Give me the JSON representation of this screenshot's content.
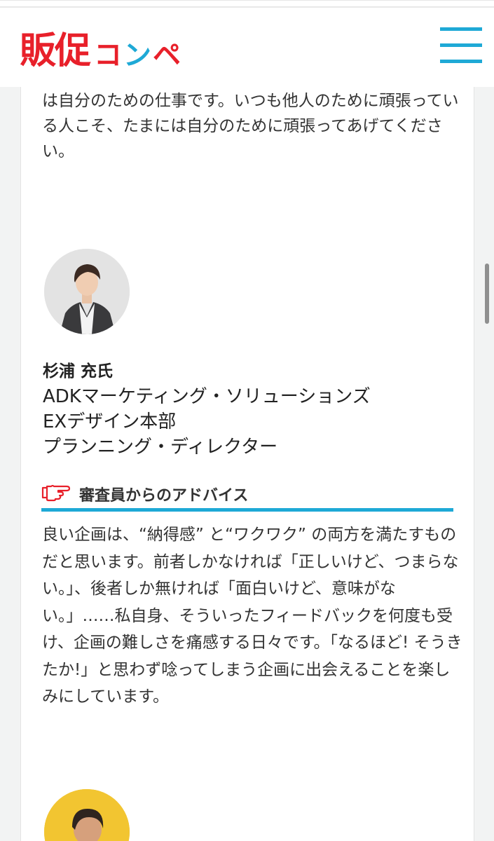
{
  "header": {
    "logo_text": "販促コンペ",
    "logo_chars": [
      "販",
      "促",
      "コ",
      "ン",
      "ペ"
    ],
    "brand_red": "#e8202a",
    "brand_blue": "#1ea9d6",
    "menu_icon": "hamburger-menu-icon"
  },
  "intro": {
    "text": "は自分のための仕事です。いつも他人のために頑張っている人こそ、たまには自分のために頑張ってあげてください。"
  },
  "judge": {
    "name": "杉浦 充氏",
    "affiliation_lines": [
      "ADKマーケティング・ソリューションズ",
      "EXデザイン本部",
      "プランニング・ディレクター"
    ],
    "avatar_icon": "judge-portrait-icon"
  },
  "advice": {
    "heading": "審査員からのアドバイス",
    "heading_icon": "pointing-hand-icon",
    "text": "良い企画は、“納得感” と“ワクワク” の両方を満たすものだと思います。前者しかなければ「正しいけど、つまらない。」、後者しか無ければ「面白いけど、意味がない。」……私自身、そういったフィードバックを何度も受け、企画の難しさを痛感する日々です。「なるほど! そうきたか!」と思わず唸ってしまう企画に出会えることを楽しみにしています。"
  },
  "next_judge": {
    "avatar_icon": "judge-portrait-icon"
  }
}
